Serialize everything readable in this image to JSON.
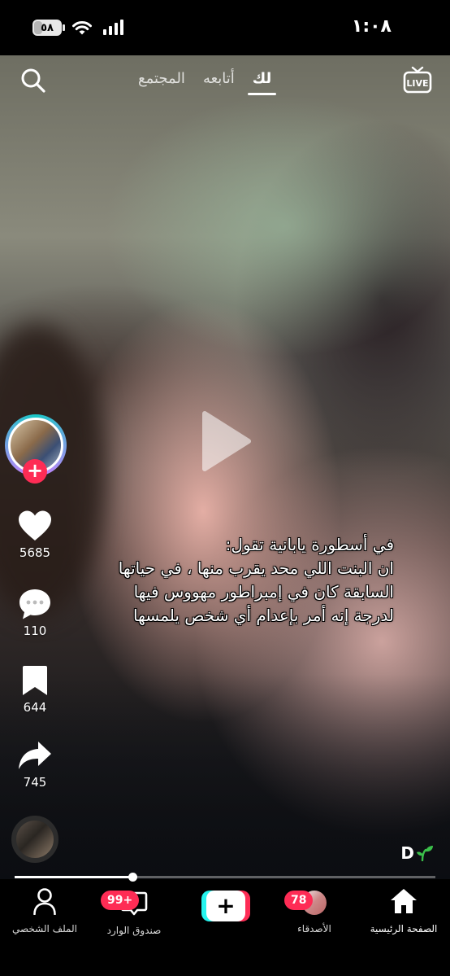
{
  "status_bar": {
    "battery": "٥٨",
    "time": "١:٠٨"
  },
  "top_nav": {
    "tabs": [
      "لك",
      "أتابعه",
      "المجتمع"
    ],
    "active_tab": "لك",
    "live_label": "LIVE"
  },
  "actions": {
    "likes": "5685",
    "comments": "110",
    "saves": "644",
    "shares": "745"
  },
  "caption": {
    "lines": [
      "في أسطورة يابانية تقول:",
      "ان البنت اللي محد يقرب منها ، في حياتها",
      "السابقة كان في إمبراطور مهووس فيها",
      "لدرجة إنه أمر بإعدام أي شخص يلمسها"
    ]
  },
  "watermark_letter": "D",
  "video_progress": 0.28,
  "bottom_nav": {
    "home": "الصفحة الرئيسية",
    "friends": "الأصدقاء",
    "friends_badge": "78",
    "inbox": "صندوق الوارد",
    "inbox_badge": "99+",
    "profile": "الملف الشخصي"
  },
  "colors": {
    "accent_red": "#fe2c55",
    "accent_cyan": "#25f4ee"
  }
}
